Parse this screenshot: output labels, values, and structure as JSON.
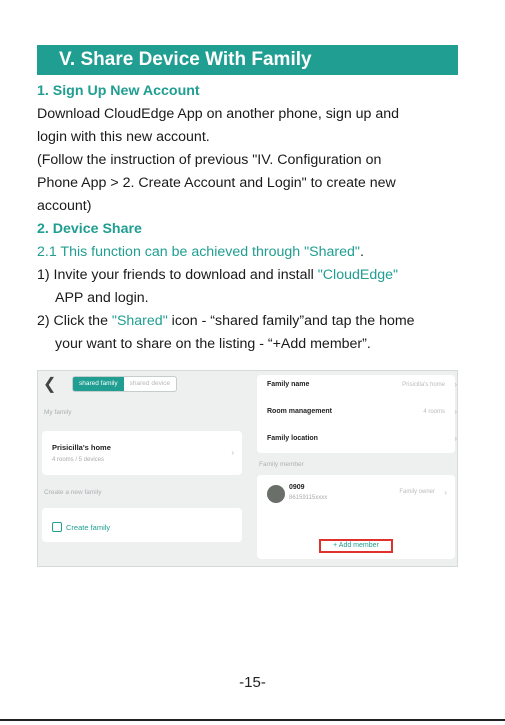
{
  "banner": {
    "title": "V. Share Device With Family"
  },
  "sections": {
    "s1_heading": "1. Sign Up New Account",
    "s1_line1": "Download CloudEdge App on another phone, sign up and",
    "s1_line2": "login with this new account.",
    "s1_line3": "(Follow the instruction of previous \"IV. Configuration on",
    "s1_line4": "Phone App > 2. Create Account and Login\" to create new",
    "s1_line5": "account)",
    "s2_heading": "2. Device Share",
    "s2_1_text": "2.1 This function can be achieved through \"Shared\"",
    "s2_1_dot": ".",
    "step1_a": "1) Invite your friends to download and install ",
    "step1_b": "\"CloudEdge\"",
    "step1_c": "APP and login.",
    "step2_a": "2) Click the ",
    "step2_b": "\"Shared\"",
    "step2_c": " icon - “shared family”and tap the home",
    "step2_d": "your want to share on the listing - “+Add member”."
  },
  "screenshot": {
    "tab_shared_family": "shared family",
    "tab_shared_device": "shared device",
    "my_family_label": "My family",
    "home_name": "Prisicilla's home",
    "home_meta": "4 rooms / 5 devices",
    "create_section_label": "Create a new family",
    "create_family": "Create family",
    "rows": {
      "family_name": "Family name",
      "family_name_val": "Prisicilla's home",
      "room_management": "Room management",
      "room_management_val": "4 rooms",
      "family_location": "Family location"
    },
    "family_member_label": "Family member",
    "member_name": "0909",
    "member_id": "86159115xxxx",
    "member_role": "Family owner",
    "add_member": "+ Add member"
  },
  "footer": {
    "page": "-15-"
  },
  "colors": {
    "accent": "#1f9e91",
    "highlight": "#e0322c"
  }
}
